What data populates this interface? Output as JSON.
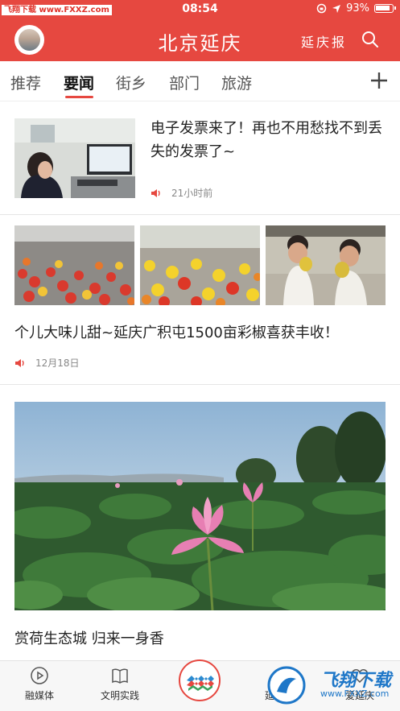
{
  "status_bar": {
    "watermark": "飞翔下载 www.FXXZ.com",
    "time": "08:54",
    "battery": "93%"
  },
  "header": {
    "title": "北京延庆",
    "paper_label": "延庆报",
    "search_icon": "search-icon",
    "bg_color": "#e64840"
  },
  "tabs": [
    {
      "label": "推荐"
    },
    {
      "label": "要闻",
      "active": true
    },
    {
      "label": "街乡"
    },
    {
      "label": "部门"
    },
    {
      "label": "旅游"
    }
  ],
  "articles": [
    {
      "title": "电子发票来了！再也不用愁找不到丢失的发票了~",
      "time": "21小时前"
    },
    {
      "title": "个儿大味儿甜~延庆广积屯1500亩彩椒喜获丰收！",
      "time": "12月18日"
    },
    {
      "title": "赏荷生态城 归来一身香"
    }
  ],
  "bottom_nav": {
    "items": [
      {
        "label": "融媒体",
        "icon": "play-icon"
      },
      {
        "label": "文明实践",
        "icon": "book-icon"
      },
      {
        "label": "延庆号",
        "icon": "user-icon"
      },
      {
        "label": "爱延庆",
        "icon": "heart-icon"
      }
    ],
    "watermark_text": "飞翔下载",
    "watermark_url": "www.FXXZ.com"
  }
}
